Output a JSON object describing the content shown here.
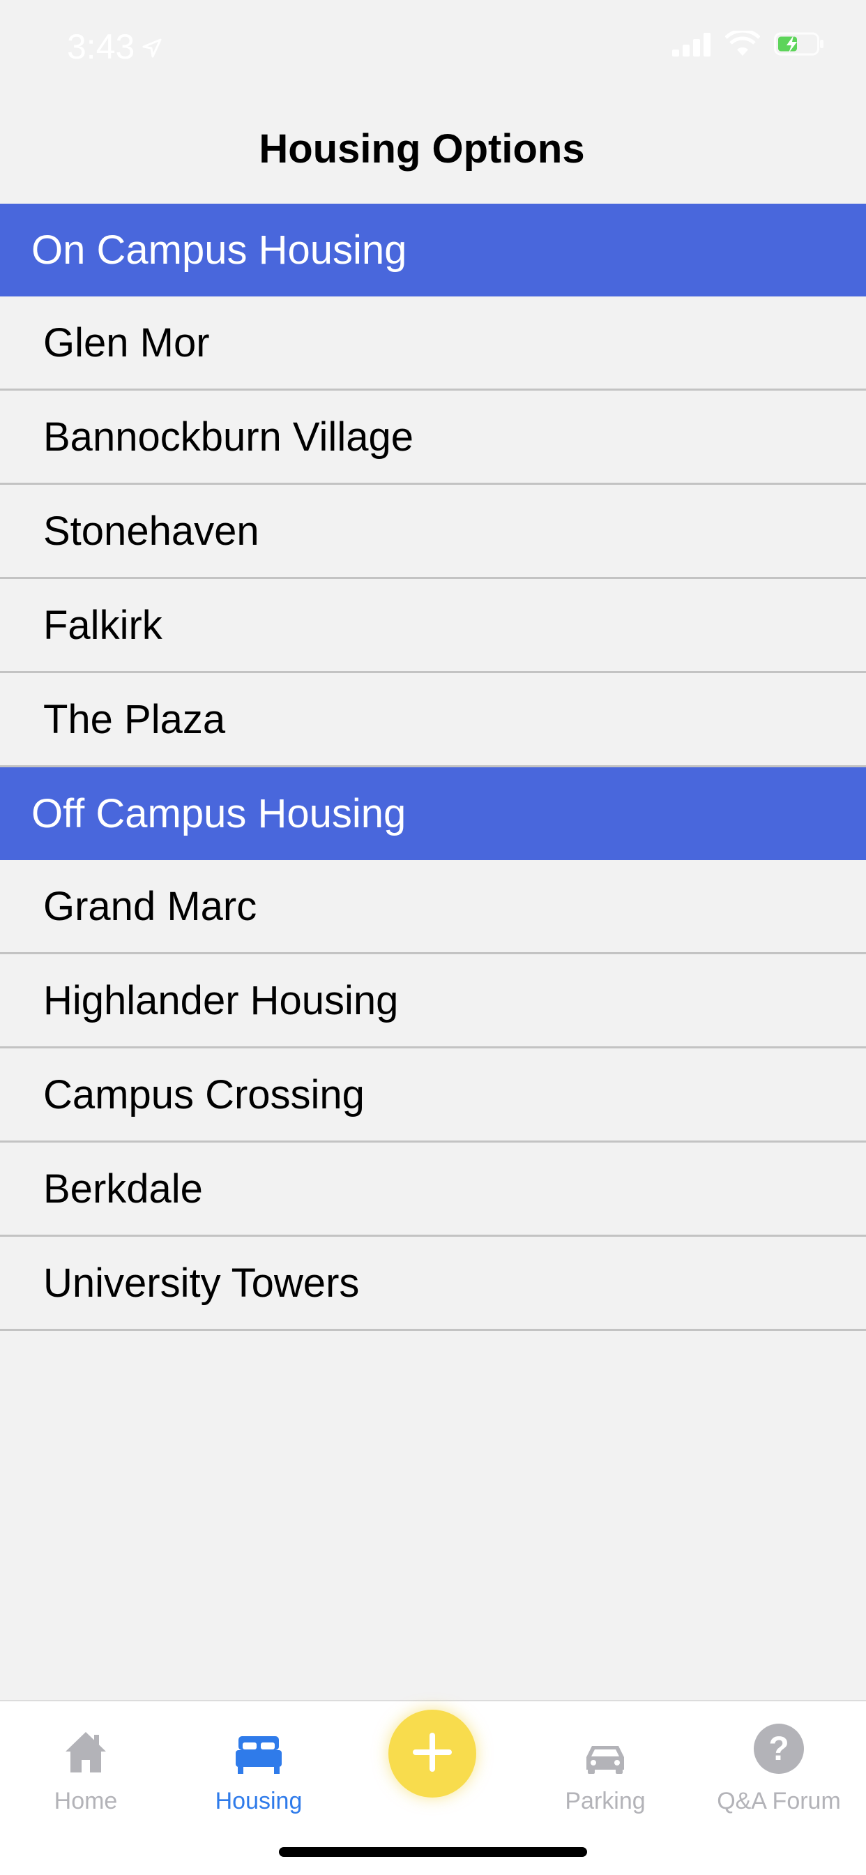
{
  "status_bar": {
    "time": "3:43"
  },
  "nav": {
    "title": "Housing Options"
  },
  "colors": {
    "section_header": "#4967dc",
    "tab_active": "#2f7bea",
    "tab_inactive": "#b3b3b8",
    "fab": "#f8dc4d"
  },
  "sections": [
    {
      "title": "On Campus Housing",
      "items": [
        "Glen Mor",
        "Bannockburn Village",
        "Stonehaven",
        "Falkirk",
        "The Plaza"
      ]
    },
    {
      "title": "Off Campus Housing",
      "items": [
        "Grand Marc",
        "Highlander Housing",
        "Campus Crossing",
        "Berkdale",
        "University Towers"
      ]
    }
  ],
  "tab_bar": {
    "tabs": [
      {
        "label": "Home",
        "icon": "home-icon",
        "active": false
      },
      {
        "label": "Housing",
        "icon": "bed-icon",
        "active": true
      },
      {
        "label": "",
        "icon": "plus-icon",
        "active": false
      },
      {
        "label": "Parking",
        "icon": "car-icon",
        "active": false
      },
      {
        "label": "Q&A Forum",
        "icon": "question-icon",
        "active": false
      }
    ]
  }
}
